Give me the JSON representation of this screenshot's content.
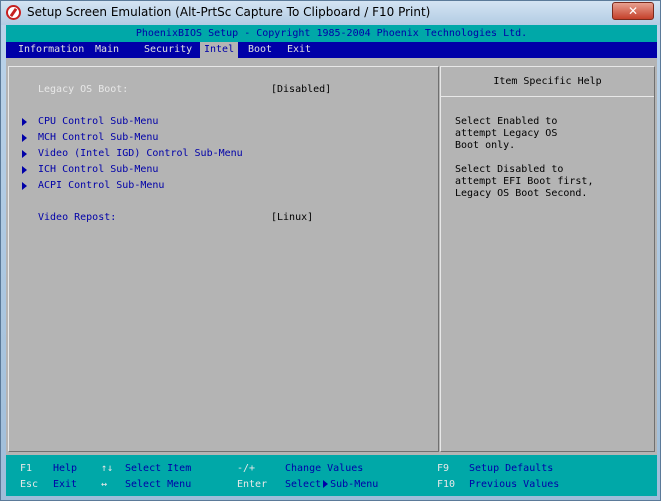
{
  "window": {
    "title": "Setup Screen Emulation (Alt-PrtSc Capture To Clipboard / F10 Print)",
    "close_label": "✕"
  },
  "bios": {
    "header": "PhoenixBIOS Setup - Copyright 1985-2004 Phoenix Technologies Ltd.",
    "menu": [
      "Information",
      "Main",
      "Security",
      "Intel",
      "Boot",
      "Exit"
    ],
    "active_menu": "Intel",
    "items": [
      {
        "label": "Legacy OS Boot:",
        "value": "[Disabled]"
      },
      {
        "label": "CPU Control Sub-Menu"
      },
      {
        "label": "MCH Control Sub-Menu"
      },
      {
        "label": "Video (Intel IGD) Control Sub-Menu"
      },
      {
        "label": "ICH Control Sub-Menu"
      },
      {
        "label": "ACPI Control Sub-Menu"
      },
      {
        "label": "Video Repost:",
        "value": "[Linux]"
      }
    ],
    "help": {
      "title": "Item Specific Help",
      "paragraph1": "Select Enabled to\nattempt Legacy OS\nBoot only.",
      "paragraph2": "Select Disabled to\nattempt EFI Boot first,\nLegacy OS Boot Second."
    },
    "footer": {
      "f1_key": "F1",
      "f1_desc": "Help",
      "esc_key": "Esc",
      "esc_desc": "Exit",
      "updown_key": "↑↓",
      "updown_desc": "Select Item",
      "leftright_key": "↔",
      "leftright_desc": "Select Menu",
      "plusminus_key": "-/+",
      "plusminus_desc": "Change Values",
      "enter_key": "Enter",
      "enter_desc_a": "Select",
      "enter_desc_b": "Sub-Menu",
      "f9_key": "F9",
      "f9_desc": "Setup Defaults",
      "f10_key": "F10",
      "f10_desc": "Previous Values"
    }
  },
  "colors": {
    "bios_background": "#b4b4b4",
    "menubar": "#0000a8",
    "cyan": "#00a8a8",
    "highlight_text": "#e8e8e8"
  }
}
